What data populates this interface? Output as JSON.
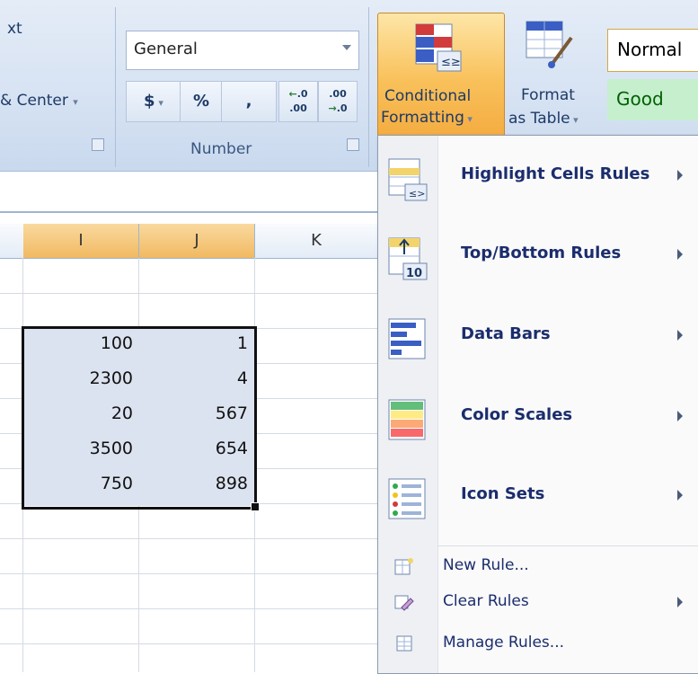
{
  "ribbon": {
    "alignment_partial_top": "xt",
    "alignment_partial_merge": "& Center",
    "number_format_value": "General",
    "number_buttons": [
      "$",
      "%",
      ",",
      "+.0 .00",
      ".00 →.0"
    ],
    "number_group_label": "Number",
    "conditional_formatting_line1": "Conditional",
    "conditional_formatting_line2": "Formatting",
    "format_table_line1": "Format",
    "format_table_line2": "as Table",
    "style_normal": "Normal",
    "style_good": "Good"
  },
  "sheet": {
    "columns": [
      "I",
      "J",
      "K"
    ],
    "rows": [
      [
        "100",
        "1"
      ],
      [
        "2300",
        "4"
      ],
      [
        "20",
        "567"
      ],
      [
        "3500",
        "654"
      ],
      [
        "750",
        "898"
      ]
    ]
  },
  "menu": {
    "big_items": [
      {
        "label": "Highlight Cells Rules",
        "icon": "highlight-cells-icon"
      },
      {
        "label": "Top/Bottom Rules",
        "icon": "top-bottom-icon"
      },
      {
        "label": "Data Bars",
        "icon": "data-bars-icon"
      },
      {
        "label": "Color Scales",
        "icon": "color-scales-icon"
      },
      {
        "label": "Icon Sets",
        "icon": "icon-sets-icon"
      }
    ],
    "small_items": [
      {
        "label": "New Rule...",
        "icon": "new-rule-icon"
      },
      {
        "label": "Clear Rules",
        "icon": "clear-rules-icon"
      },
      {
        "label": "Manage Rules...",
        "icon": "manage-rules-icon"
      }
    ]
  },
  "colors": {
    "selected_header": "#f1b961",
    "menu_text": "#1b2d6d",
    "good_style_bg": "#c6efce"
  }
}
